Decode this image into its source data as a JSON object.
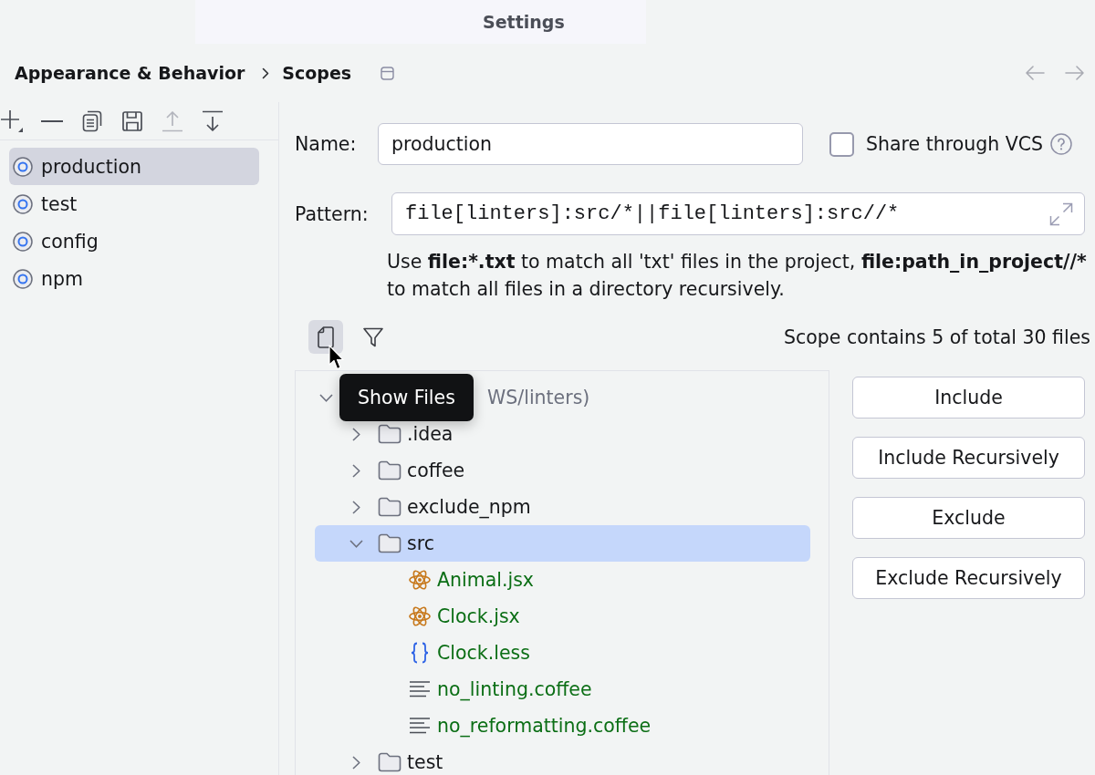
{
  "window": {
    "title": "Settings"
  },
  "breadcrumb": [
    "Appearance & Behavior",
    "Scopes"
  ],
  "scopes_toolbar": [
    {
      "kind": "add",
      "disabled": false
    },
    {
      "kind": "remove",
      "disabled": false
    },
    {
      "kind": "copy",
      "disabled": false
    },
    {
      "kind": "save",
      "disabled": false
    },
    {
      "kind": "move_up",
      "disabled": true
    },
    {
      "kind": "move_down",
      "disabled": false
    }
  ],
  "scopes": [
    {
      "name": "production",
      "selected": true
    },
    {
      "name": "test",
      "selected": false
    },
    {
      "name": "config",
      "selected": false
    },
    {
      "name": "npm",
      "selected": false
    }
  ],
  "name_field": {
    "label": "Name:",
    "value": "production"
  },
  "share_vcs": {
    "label": "Share through VCS",
    "checked": false
  },
  "pattern_field": {
    "label": "Pattern:",
    "value": "file[linters]:src/*||file[linters]:src//*"
  },
  "hint": {
    "lines": [
      [
        {
          "text": "Use ",
          "bold": false
        },
        {
          "text": "file:*.txt",
          "bold": true
        },
        {
          "text": " to match all 'txt' files in the project, ",
          "bold": false
        },
        {
          "text": "file:path_in_project//*",
          "bold": true
        }
      ],
      [
        {
          "text": "to match all files in a directory recursively.",
          "bold": false
        }
      ]
    ]
  },
  "tree_toolbar": [
    {
      "kind": "show_files",
      "selected": true
    },
    {
      "kind": "filter",
      "selected": false
    }
  ],
  "scope_summary": "Scope contains 5 of total 30 files",
  "tooltip": "Show Files",
  "tree": {
    "kind": "project",
    "label": "WS/linters)",
    "expanded": true,
    "selected": false,
    "in_scope": false,
    "children": [
      {
        "kind": "folder",
        "label": ".idea",
        "expanded": false,
        "selected": false,
        "in_scope": false
      },
      {
        "kind": "folder",
        "label": "coffee",
        "expanded": false,
        "selected": false,
        "in_scope": false
      },
      {
        "kind": "folder",
        "label": "exclude_npm",
        "expanded": false,
        "selected": false,
        "in_scope": false
      },
      {
        "kind": "folder",
        "label": "src",
        "expanded": true,
        "selected": true,
        "in_scope": false,
        "children": [
          {
            "kind": "jsx",
            "label": "Animal.jsx",
            "selected": false,
            "in_scope": true
          },
          {
            "kind": "jsx",
            "label": "Clock.jsx",
            "selected": false,
            "in_scope": true
          },
          {
            "kind": "less",
            "label": "Clock.less",
            "selected": false,
            "in_scope": true
          },
          {
            "kind": "text",
            "label": "no_linting.coffee",
            "selected": false,
            "in_scope": true
          },
          {
            "kind": "text",
            "label": "no_reformatting.coffee",
            "selected": false,
            "in_scope": true
          }
        ]
      },
      {
        "kind": "folder",
        "label": "test",
        "expanded": false,
        "selected": false,
        "in_scope": false
      }
    ]
  },
  "buttons": [
    "Include",
    "Include Recursively",
    "Exclude",
    "Exclude Recursively"
  ]
}
